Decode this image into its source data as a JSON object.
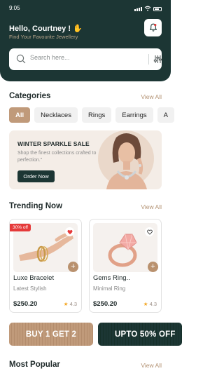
{
  "status": {
    "time": "9:05"
  },
  "header": {
    "greeting": "Hello, Courtney ! ✋",
    "subtitle": "Find Your Favourite Jewellery"
  },
  "search": {
    "placeholder": "Search here..."
  },
  "categories": {
    "title": "Categories",
    "view_all": "View All",
    "chips": [
      {
        "label": "All",
        "active": true
      },
      {
        "label": "Necklaces"
      },
      {
        "label": "Rings"
      },
      {
        "label": "Earrings"
      },
      {
        "label": "A"
      }
    ]
  },
  "banner": {
    "title": "WINTER SPARKLE SALE",
    "text": "Shop the finest collections crafted to perfection.\"",
    "button": "Order Now"
  },
  "trending": {
    "title": "Trending Now",
    "view_all": "View All",
    "products": [
      {
        "badge": "30% off",
        "name": "Luxe Bracelet",
        "subtitle": "Latest Stylish",
        "price": "$250.20",
        "rating": "4.3",
        "favorite": true
      },
      {
        "name": "Gems Ring..",
        "subtitle": "Minimal Ring",
        "price": "$250.20",
        "rating": "4.3",
        "favorite": false
      }
    ]
  },
  "promos": [
    {
      "label": "BUY 1 GET 2"
    },
    {
      "label": "UPTO 50% OFF"
    }
  ],
  "most_popular": {
    "title": "Most Popular",
    "view_all": "View All"
  },
  "colors": {
    "primary_dark": "#1c3634",
    "accent_brown": "#c09a7a",
    "sale_red": "#e53a3a",
    "star": "#f4a623"
  }
}
